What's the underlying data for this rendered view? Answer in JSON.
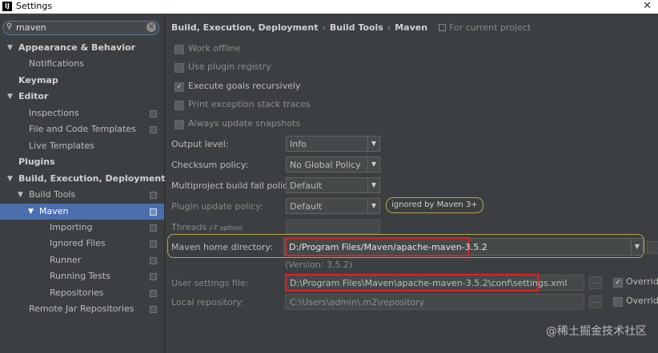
{
  "window": {
    "title": "Settings",
    "app_icon": "IJ"
  },
  "search": {
    "value": "maven"
  },
  "tree": [
    {
      "label": "Appearance & Behavior",
      "arrow": "▼"
    },
    {
      "label": "Notifications"
    },
    {
      "label": "Keymap"
    },
    {
      "label": "Editor",
      "arrow": "▼"
    },
    {
      "label": "Inspections"
    },
    {
      "label": "File and Code Templates"
    },
    {
      "label": "Live Templates"
    },
    {
      "label": "Plugins"
    },
    {
      "label": "Build, Execution, Deployment",
      "arrow": "▼"
    },
    {
      "label": "Build Tools",
      "arrow": "▼"
    },
    {
      "label": "Maven",
      "arrow": "▼"
    },
    {
      "label": "Importing"
    },
    {
      "label": "Ignored Files"
    },
    {
      "label": "Runner"
    },
    {
      "label": "Running Tests"
    },
    {
      "label": "Repositories"
    },
    {
      "label": "Remote Jar Repositories"
    }
  ],
  "breadcrumb": {
    "part1": "Build, Execution, Deployment",
    "part2": "Build Tools",
    "part3": "Maven",
    "sep": "›",
    "for_project": "For current project"
  },
  "checkboxes": [
    {
      "label": "Work offline",
      "checked": false
    },
    {
      "label": "Use plugin registry",
      "checked": false
    },
    {
      "label": "Execute goals recursively",
      "checked": true
    },
    {
      "label": "Print exception stack traces",
      "checked": false
    },
    {
      "label": "Always update snapshots",
      "checked": false
    }
  ],
  "form": {
    "output_level": {
      "label": "Output level:",
      "value": "Info"
    },
    "checksum_policy": {
      "label": "Checksum policy:",
      "value": "No Global Policy"
    },
    "multiproject_fail": {
      "label": "Multiproject build fail policy:",
      "value": "Default"
    },
    "plugin_update": {
      "label": "Plugin update policy:",
      "value": "Default",
      "badge": "ignored by Maven 3+"
    },
    "threads": {
      "label": "Threads",
      "hint": "(-T option)"
    },
    "maven_home": {
      "label": "Maven home directory:",
      "value": "D:/Program Files/Maven/apache-maven-3.5.2",
      "version": "(Version: 3.5.2)"
    },
    "user_settings": {
      "label": "User settings file:",
      "value": "D:\\Program Files\\Maven\\apache-maven-3.5.2\\conf\\settings.xml",
      "override": "Override",
      "override_checked": true
    },
    "local_repo": {
      "label": "Local repository:",
      "value": "C:\\Users\\admin\\.m2\\repository",
      "override": "Override",
      "override_checked": false
    }
  },
  "icons": {
    "check": "✓",
    "dropdown": "▼",
    "browse": "...",
    "search": "🔍",
    "clear": "✕",
    "close": "✕"
  },
  "watermark": "@稀土掘金技术社区",
  "colors": {
    "selection": "#4b6eaf",
    "highlight": "#e02020",
    "badge_border": "#b5a34f"
  }
}
